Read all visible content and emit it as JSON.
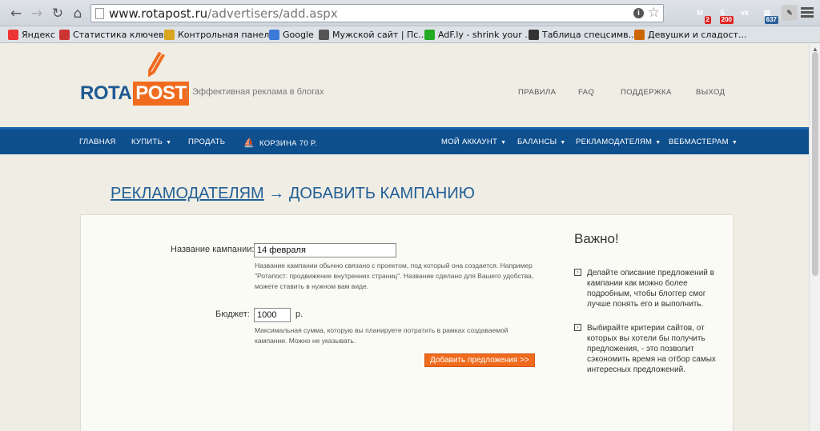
{
  "browser": {
    "url_host": "www.rotapost.ru",
    "url_path": "/advertisers/add.aspx",
    "extensions": [
      {
        "name": "red-extension-icon",
        "badge": "",
        "color": "#c7352b"
      },
      {
        "name": "gmail-extension-icon",
        "badge": "2",
        "color": "#c9302c"
      },
      {
        "name": "seo-extension-icon",
        "badge": "200",
        "color": "#b33"
      },
      {
        "name": "vk-extension-icon",
        "badge": "",
        "color": "#4a76a8"
      },
      {
        "name": "counter-extension-icon",
        "badge": "637",
        "color": "#2b5f9a"
      }
    ],
    "bookmarks": [
      {
        "label": "Яндекс",
        "icon": "yandex-icon",
        "color": "#e33"
      },
      {
        "label": "Статистика ключев...",
        "icon": "stats-icon",
        "color": "#c33"
      },
      {
        "label": "Контрольная панел...",
        "icon": "folder-icon",
        "color": "#d9a520"
      },
      {
        "label": "Google",
        "icon": "google-icon",
        "color": "#3b7ad9"
      },
      {
        "label": "Мужской сайт | Пс...",
        "icon": "site-icon",
        "color": "#555"
      },
      {
        "label": "AdF.ly - shrink your ...",
        "icon": "adfly-icon",
        "color": "#2a2"
      },
      {
        "label": "Таблица спецсимв...",
        "icon": "table-icon",
        "color": "#333"
      },
      {
        "label": "Девушки и сладост...",
        "icon": "sweets-icon",
        "color": "#c60"
      }
    ]
  },
  "site": {
    "logo_rota": "ROTA",
    "logo_post": "POST",
    "tagline": "Эффективная реклама в блогах",
    "top_links": [
      "ПРАВИЛА",
      "FAQ",
      "ПОДДЕРЖКА",
      "ВЫХОД"
    ],
    "nav_left": [
      {
        "label": "ГЛАВНАЯ",
        "caret": false
      },
      {
        "label": "КУПИТЬ",
        "caret": true
      },
      {
        "label": "ПРОДАТЬ",
        "caret": false
      },
      {
        "label": "КОРЗИНА 70 Р.",
        "caret": false
      }
    ],
    "nav_right": [
      {
        "label": "МОЙ АККАУНТ",
        "caret": true
      },
      {
        "label": "БАЛАНСЫ",
        "caret": true
      },
      {
        "label": "РЕКЛАМОДАТЕЛЯМ",
        "caret": true
      },
      {
        "label": "ВЕБМАСТЕРАМ",
        "caret": true
      }
    ]
  },
  "page": {
    "breadcrumb_link": "РЕКЛАМОДАТЕЛЯМ",
    "breadcrumb_arrow": "→",
    "breadcrumb_current": "ДОБАВИТЬ КАМПАНИЮ",
    "form": {
      "campaign_label": "Название кампании:",
      "campaign_value": "14 февраля",
      "campaign_hint": "Название кампании обычно связано с проектом, под который она создается. Например \"Ротапост: продвижение внутренних страниц\". Название сделано для Вашего удобства, можете ставить в нужном вам виде.",
      "budget_label": "Бюджет:",
      "budget_value": "1000",
      "budget_unit": "р.",
      "budget_hint": "Максимальная сумма, которую вы планируете потратить в рамках создаваемой кампании. Можно не указывать.",
      "submit_label": "Добавить предложения >>"
    },
    "sidebar": {
      "title": "Важно!",
      "items": [
        "Делайте описание предложений в кампании как можно более подробным, чтобы блоггер смог лучше понять его и выполнить.",
        "Выбирайте критерии сайтов, от которых вы хотели бы получить предложения, - это позволит сэкономить время на отбор самых интересных предложений."
      ]
    }
  },
  "colors": {
    "brand_blue": "#0e4f8e",
    "brand_orange": "#f06b1e",
    "page_bg": "#efede4"
  }
}
